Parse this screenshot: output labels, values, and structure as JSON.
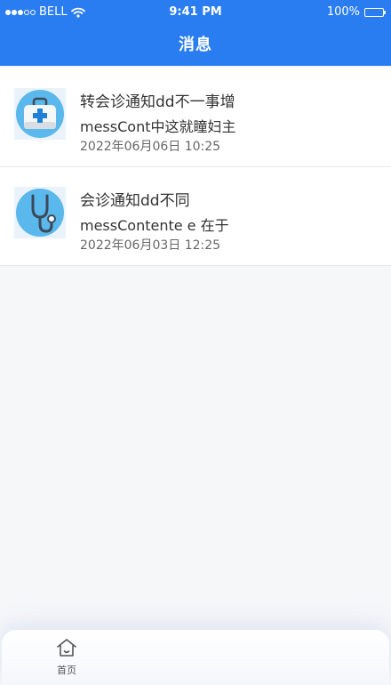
{
  "status_bar": {
    "carrier": "BELL",
    "time": "9:41 PM",
    "battery": "100%",
    "battery_level": 1.0
  },
  "nav": {
    "title": "消息"
  },
  "messages": [
    {
      "icon": "medical-kit-icon",
      "title": "转会诊通知dd不一事增",
      "content": "messCont中这就瞳妇主",
      "time": "2022年06月06日  10:25"
    },
    {
      "icon": "stethoscope-icon",
      "title": "会诊通知dd不同",
      "content": "messContente e 在于",
      "time": "2022年06月03日  12:25"
    }
  ],
  "tabbar": {
    "items": [
      {
        "label": "首页",
        "icon": "home-icon"
      }
    ]
  },
  "colors": {
    "brand": "#2a7df0",
    "icon_circle": "#5ab8ec",
    "background": "#f6f7f9"
  }
}
